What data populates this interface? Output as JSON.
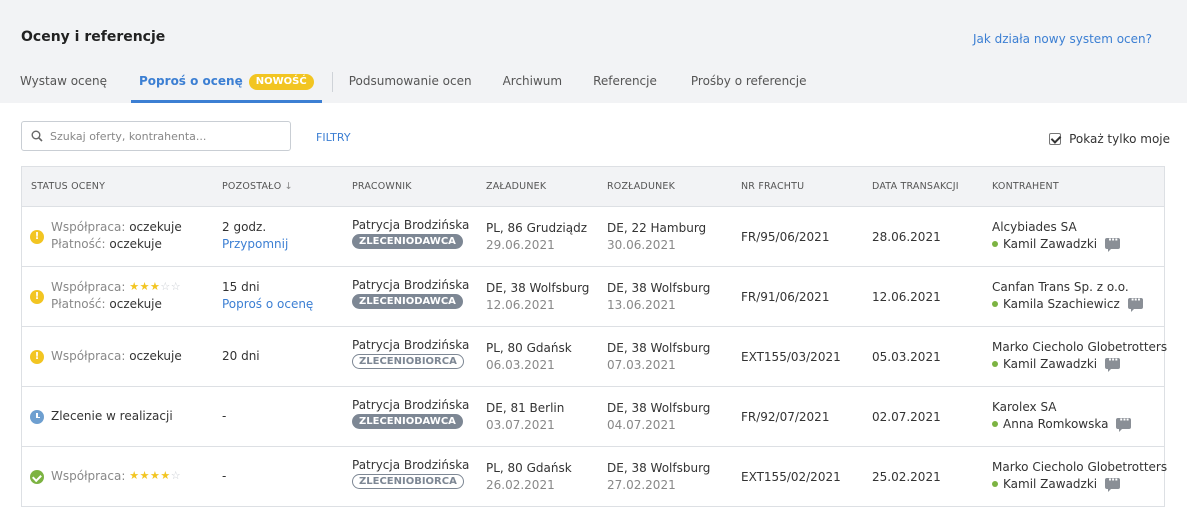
{
  "header": {
    "title": "Oceny i referencje",
    "help_link": "Jak działa nowy system ocen?"
  },
  "tabs": [
    {
      "label": "Wystaw ocenę"
    },
    {
      "label": "Poproś o ocenę",
      "badge": "NOWOŚĆ",
      "active": true
    },
    {
      "label": "Podsumowanie ocen"
    },
    {
      "label": "Archiwum"
    },
    {
      "label": "Referencje"
    },
    {
      "label": "Prośby o referencje"
    }
  ],
  "search": {
    "placeholder": "Szukaj oferty, kontrahenta..."
  },
  "filters_label": "FILTRY",
  "only_mine_label": "Pokaż tylko moje",
  "table": {
    "columns": [
      "STATUS OCENY",
      "POZOSTAŁO",
      "PRACOWNIK",
      "ZAŁADUNEK",
      "ROZŁADUNEK",
      "NR FRACHTU",
      "DATA TRANSAKCJI",
      "KONTRAHENT"
    ],
    "sort_arrow": "↓",
    "rows": [
      {
        "status_icon": "warning-icon",
        "status_line1_label": "Współpraca:",
        "status_line1_value": "oczekuje",
        "rating1": null,
        "status_line2_label": "Płatność:",
        "status_line2_value": "oczekuje",
        "remaining": "2 godz.",
        "action": "Przypomnij",
        "employee": "Patrycja Brodzińska",
        "role": "ZLECENIODAWCA",
        "loading": "PL, 86 Grudziądz",
        "loading_date": "29.06.2021",
        "unloading": "DE, 22 Hamburg",
        "unloading_date": "30.06.2021",
        "freight_no": "FR/95/06/2021",
        "transaction_date": "28.06.2021",
        "contractor": "Alcybiades SA",
        "contact": "Kamil Zawadzki"
      },
      {
        "status_icon": "warning-icon",
        "status_line1_label": "Współpraca:",
        "status_line1_value": "",
        "rating1": 3,
        "status_line2_label": "Płatność:",
        "status_line2_value": "oczekuje",
        "remaining": "15 dni",
        "action": "Poproś o ocenę",
        "employee": "Patrycja Brodzińska",
        "role": "ZLECENIODAWCA",
        "loading": "DE, 38 Wolfsburg",
        "loading_date": "12.06.2021",
        "unloading": "DE, 38 Wolfsburg",
        "unloading_date": "13.06.2021",
        "freight_no": "FR/91/06/2021",
        "transaction_date": "12.06.2021",
        "contractor": "Canfan Trans Sp. z o.o.",
        "contact": "Kamila Szachiewicz"
      },
      {
        "status_icon": "warning-icon",
        "status_line1_label": "Współpraca:",
        "status_line1_value": "oczekuje",
        "rating1": null,
        "status_line2_label": "",
        "status_line2_value": "",
        "remaining": "20 dni",
        "action": "",
        "employee": "Patrycja Brodzińska",
        "role": "ZLECENIOBIORCA",
        "loading": "PL, 80 Gdańsk",
        "loading_date": "06.03.2021",
        "unloading": "DE, 38 Wolfsburg",
        "unloading_date": "07.03.2021",
        "freight_no": "EXT155/03/2021",
        "transaction_date": "05.03.2021",
        "contractor": "Marko Ciecholo Globetrotters",
        "contact": "Kamil Zawadzki"
      },
      {
        "status_icon": "clock-icon",
        "status_line1_label": "",
        "status_line1_value": "Zlecenie w realizacji",
        "rating1": null,
        "status_line2_label": "",
        "status_line2_value": "",
        "remaining": "-",
        "action": "",
        "employee": "Patrycja Brodzińska",
        "role": "ZLECENIODAWCA",
        "loading": "DE, 81 Berlin",
        "loading_date": "03.07.2021",
        "unloading": "DE, 38 Wolfsburg",
        "unloading_date": "04.07.2021",
        "freight_no": "FR/92/07/2021",
        "transaction_date": "02.07.2021",
        "contractor": "Karolex SA",
        "contact": "Anna Romkowska"
      },
      {
        "status_icon": "check-icon",
        "status_line1_label": "Współpraca:",
        "status_line1_value": "",
        "rating1": 4,
        "status_line2_label": "",
        "status_line2_value": "",
        "remaining": "-",
        "action": "",
        "employee": "Patrycja Brodzińska",
        "role": "ZLECENIOBIORCA",
        "loading": "PL, 80 Gdańsk",
        "loading_date": "26.02.2021",
        "unloading": "DE, 38 Wolfsburg",
        "unloading_date": "27.02.2021",
        "freight_no": "EXT155/02/2021",
        "transaction_date": "25.02.2021",
        "contractor": "Marko Ciecholo Globetrotters",
        "contact": "Kamil Zawadzki"
      }
    ]
  },
  "colors": {
    "accent": "#3c7fd3",
    "badge": "#f2c522",
    "warning": "#f2c522",
    "success": "#7cb342",
    "info": "#6e9fd0",
    "role_badge": "#7d8794"
  }
}
